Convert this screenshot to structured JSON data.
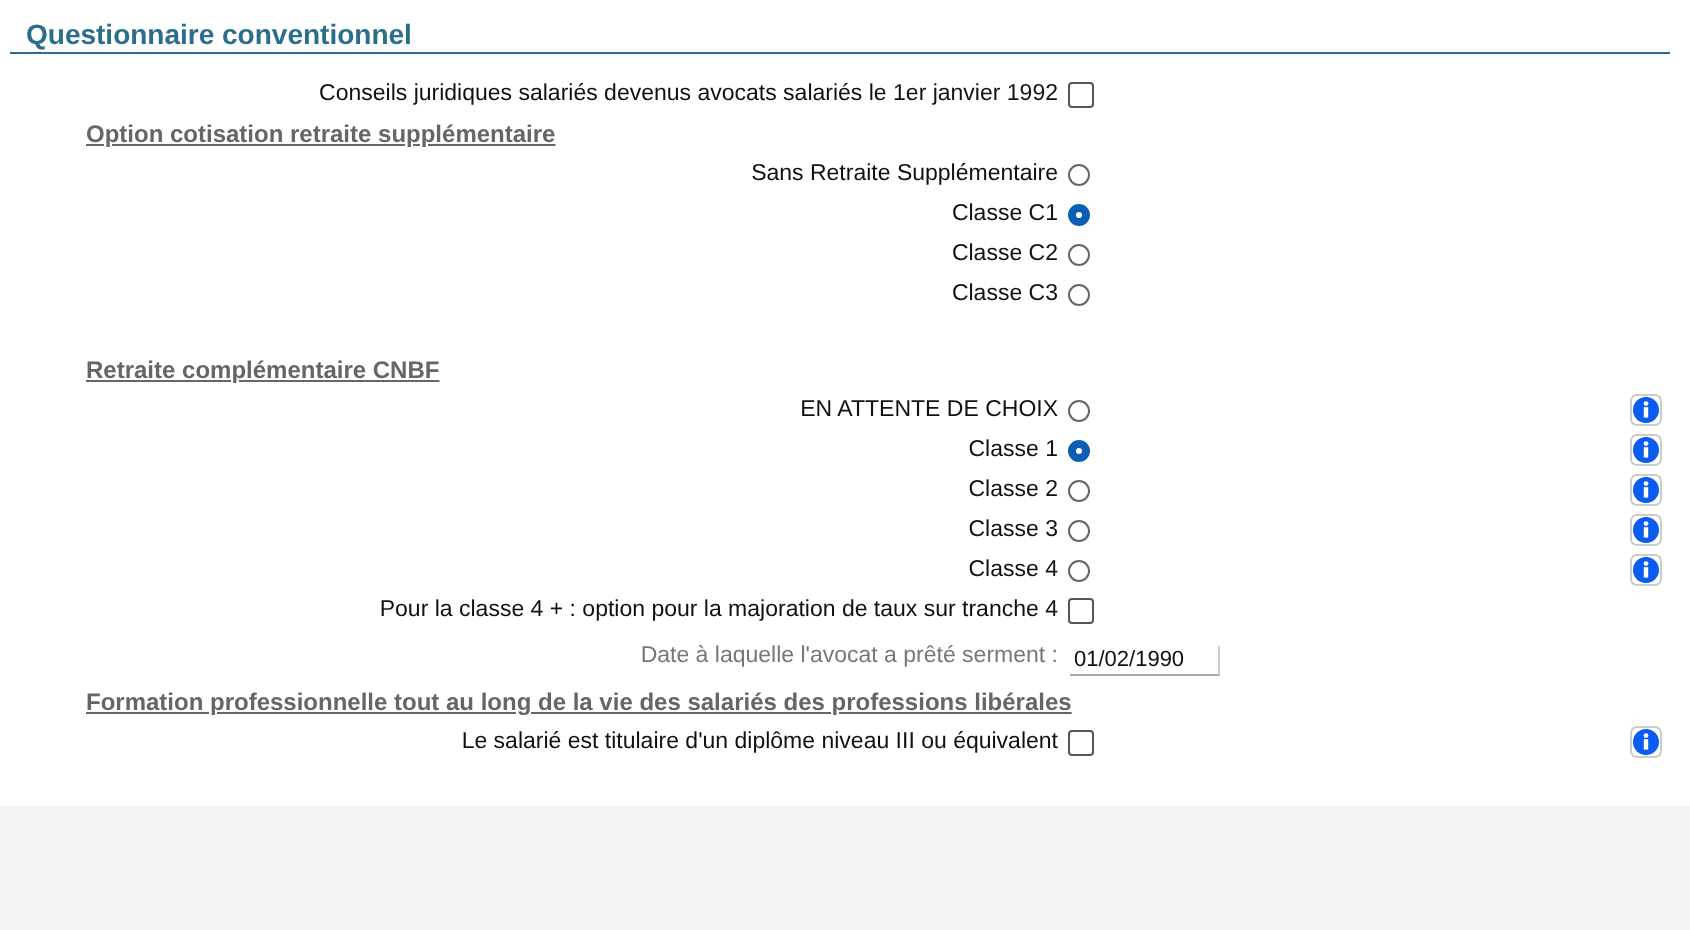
{
  "title": "Questionnaire conventionnel",
  "items": [
    {
      "kind": "checkbox",
      "label": "Conseils juridiques salariés devenus avocats salariés le 1er janvier 1992",
      "checked": false,
      "info": false
    },
    {
      "kind": "heading",
      "label": "Option cotisation retraite supplémentaire"
    },
    {
      "kind": "radio",
      "label": "Sans Retraite Supplémentaire",
      "selected": false,
      "info": false
    },
    {
      "kind": "radio",
      "label": "Classe C1",
      "selected": true,
      "info": false
    },
    {
      "kind": "radio",
      "label": "Classe C2",
      "selected": false,
      "info": false
    },
    {
      "kind": "radio",
      "label": "Classe C3",
      "selected": false,
      "info": false
    },
    {
      "kind": "heading",
      "label": "Retraite complémentaire CNBF"
    },
    {
      "kind": "radio",
      "label": "EN ATTENTE DE CHOIX",
      "selected": false,
      "info": true
    },
    {
      "kind": "radio",
      "label": "Classe 1",
      "selected": true,
      "info": true
    },
    {
      "kind": "radio",
      "label": "Classe 2",
      "selected": false,
      "info": true
    },
    {
      "kind": "radio",
      "label": "Classe 3",
      "selected": false,
      "info": true
    },
    {
      "kind": "radio",
      "label": "Classe 4",
      "selected": false,
      "info": true
    },
    {
      "kind": "checkbox",
      "label": "Pour la classe 4 + : option pour la majoration de taux sur tranche 4",
      "checked": false,
      "info": false
    },
    {
      "kind": "date",
      "label": "Date à laquelle l'avocat a prêté serment :",
      "value": "01/02/1990"
    },
    {
      "kind": "heading",
      "label": "Formation professionnelle tout au long de la vie des salariés des professions libérales"
    },
    {
      "kind": "checkbox",
      "label": "Le salarié est titulaire d'un diplôme niveau III ou équivalent",
      "checked": false,
      "info": true
    }
  ]
}
